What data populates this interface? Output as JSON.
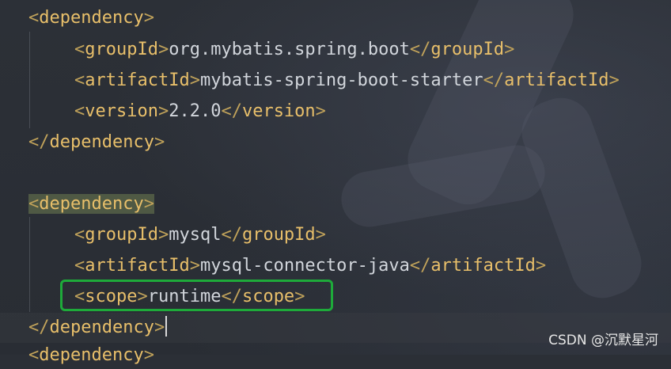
{
  "editor": {
    "lines": [
      {
        "open": "<",
        "name": "dependency",
        "close": ">"
      },
      {
        "o1": "<",
        "t1": "groupId",
        "c1": ">",
        "value": "org.mybatis.spring.boot",
        "o2": "</",
        "t2": "groupId",
        "c2": ">"
      },
      {
        "o1": "<",
        "t1": "artifactId",
        "c1": ">",
        "value": "mybatis-spring-boot-starter",
        "o2": "</",
        "t2": "artifactId",
        "c2": ">"
      },
      {
        "o1": "<",
        "t1": "version",
        "c1": ">",
        "value": "2.2.0",
        "o2": "</",
        "t2": "version",
        "c2": ">"
      },
      {
        "open": "</",
        "name": "dependency",
        "close": ">"
      },
      {
        "open": "<",
        "name": "dependency",
        "close": ">"
      },
      {
        "o1": "<",
        "t1": "groupId",
        "c1": ">",
        "value": "mysql",
        "o2": "</",
        "t2": "groupId",
        "c2": ">"
      },
      {
        "o1": "<",
        "t1": "artifactId",
        "c1": ">",
        "value": "mysql-connector-java",
        "o2": "</",
        "t2": "artifactId",
        "c2": ">"
      },
      {
        "o1": "<",
        "t1": "scope",
        "c1": ">",
        "value": "runtime",
        "o2": "</",
        "t2": "scope",
        "c2": ">"
      },
      {
        "open": "</",
        "name": "dependency",
        "close": ">"
      },
      {
        "open": "<",
        "name": "dependency",
        "close": ">"
      }
    ],
    "highlight_color": "#1eaa3a"
  },
  "watermark": {
    "text": "CSDN @沉默星河"
  }
}
